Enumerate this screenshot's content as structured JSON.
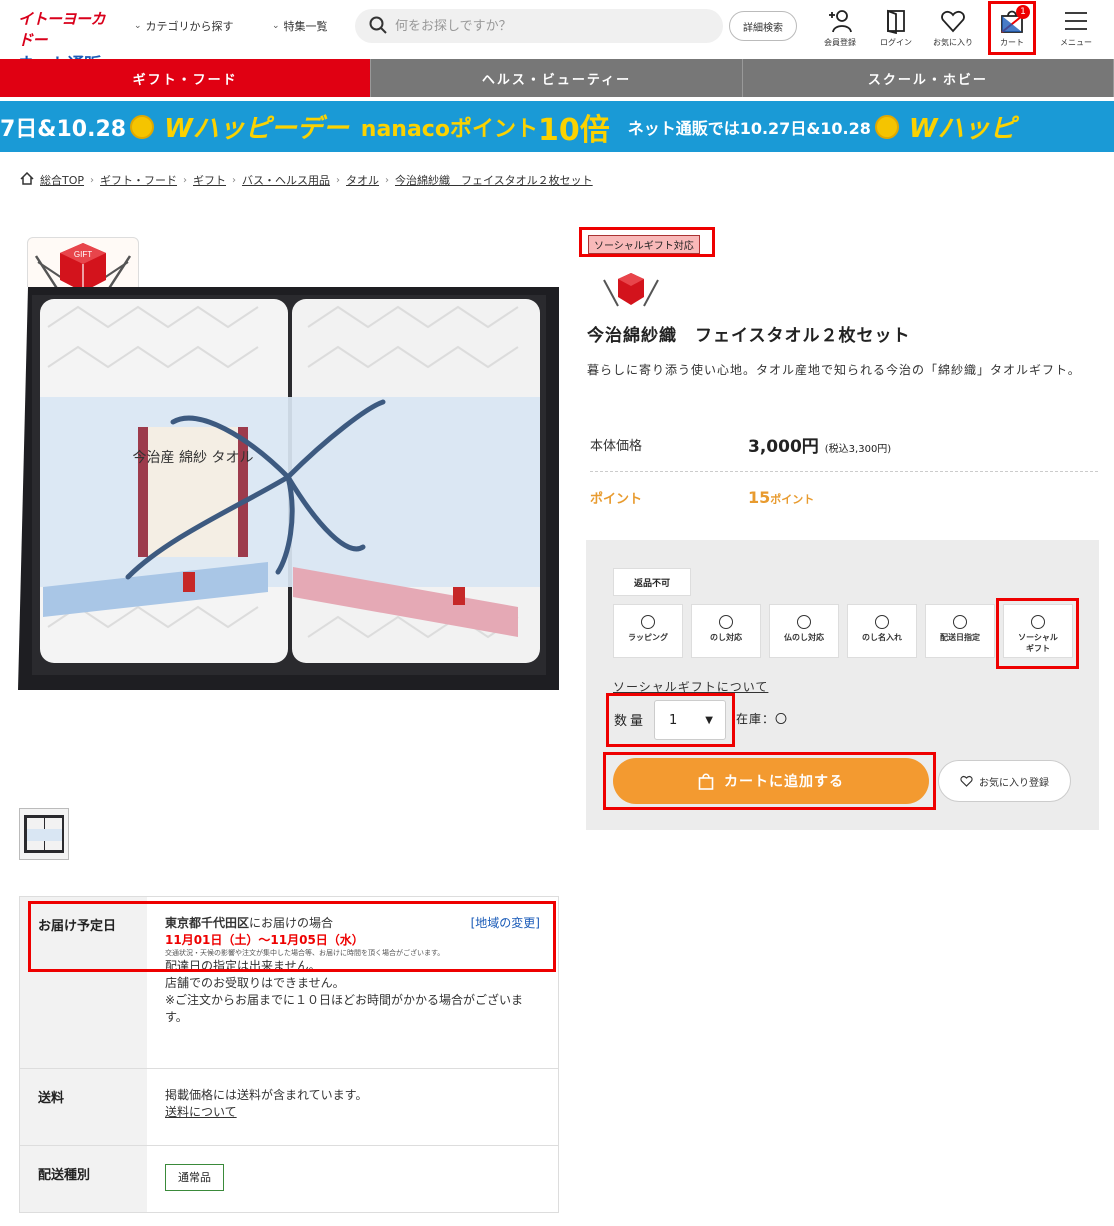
{
  "header": {
    "logo_line1": "イトーヨーカドー",
    "logo_line2": "ネット通販",
    "nav_category": "カテゴリから探す",
    "nav_feature": "特集一覧",
    "search_placeholder": "何をお探しですか？",
    "detail_search": "詳細検索",
    "icons": [
      {
        "name": "member-register-icon",
        "label": "会員登録"
      },
      {
        "name": "login-icon",
        "label": "ログイン"
      },
      {
        "name": "favorites-icon",
        "label": "お気に入り"
      },
      {
        "name": "cart-icon",
        "label": "カート"
      },
      {
        "name": "menu-icon",
        "label": "メニュー"
      }
    ],
    "cart_count": "1"
  },
  "category_tabs": [
    {
      "label": "ギフト・フード",
      "active": true
    },
    {
      "label": "ヘルス・ビューティー",
      "active": false
    },
    {
      "label": "スクール・ホビー",
      "active": false
    }
  ],
  "banner": {
    "date_left": "7日&10.28",
    "w_happy": "Wハッピーデー",
    "nanaco": "nanacoポイント",
    "ten": "10倍",
    "net_text": "ネット通販では10.27日&10.28",
    "w_happy2": "Wハッピ"
  },
  "breadcrumb": [
    "総合TOP",
    "ギフト・フード",
    "ギフト",
    "バス・ヘルス用品",
    "タオル",
    "今治綿紗織　フェイスタオル２枚セット"
  ],
  "product": {
    "social_tag": "ソーシャルギフト対応",
    "title": "今治綿紗織　フェイスタオル２枚セット",
    "description": "暮らしに寄り添う使い心地。タオル産地で知られる今治の「綿紗織」タオルギフト。",
    "price_label": "本体価格",
    "price": "3,000円",
    "price_tax": "(税込3,300円)",
    "point_label": "ポイント",
    "point_value": "15",
    "point_unit": "ポイント",
    "image_label_gift": "GIFT",
    "image_label_box": "今治産 綿紗 タオル"
  },
  "options": {
    "no_return": "返品不可",
    "items": [
      {
        "line1": "ラッピング",
        "line2": ""
      },
      {
        "line1": "のし対応",
        "line2": ""
      },
      {
        "line1": "仏のし対応",
        "line2": ""
      },
      {
        "line1": "のし名入れ",
        "line2": ""
      },
      {
        "line1": "配送日指定",
        "line2": ""
      },
      {
        "line1": "ソーシャル",
        "line2": "ギフト"
      }
    ],
    "social_link": "ソーシャルギフトについて",
    "qty_label": "数量",
    "qty_value": "1",
    "stock": "在庫：〇",
    "cart_button": "カートに追加する",
    "fav_button": "お気に入り登録"
  },
  "delivery": {
    "label": "お届け予定日",
    "region": "東京都千代田区",
    "region_suffix": "にお届けの場合",
    "change": "[地域の変更]",
    "date": "11月01日（土）〜11月05日（水）",
    "note": "交通状況・天候の影響や注文が集中した場合等、お届けに時間を頂く場合がございます。",
    "lines": [
      "配達日の指定は出来ません。",
      "店舗でのお受取りはできません。",
      "※ご注文からお届までに１０日ほどお時間がかかる場合がございます。"
    ],
    "shipping_label": "送料",
    "shipping_text": "掲載価格には送料が含まれています。",
    "shipping_link": "送料について",
    "type_label": "配送種別",
    "type_value": "通常品"
  }
}
